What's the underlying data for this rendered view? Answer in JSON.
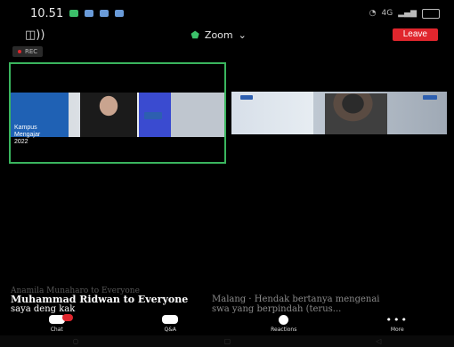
{
  "status": {
    "time": "10.51",
    "signal_text": "4G"
  },
  "header": {
    "meeting_title": "Zoom",
    "leave_label": "Leave"
  },
  "recording": {
    "label": "REC"
  },
  "video_left": {
    "brand_line1": "Kampus",
    "brand_line2": "Mengajar",
    "brand_line3": "2022"
  },
  "chat": {
    "previous_sender": "Anamila Munaharo to Everyone",
    "sender": "Muhammad Ridwan to Everyone",
    "sender_faded": "Malang · Hendak bertanya mengenai",
    "message": "saya deng kak",
    "message_faded": "swa yang berpindah (terus..."
  },
  "toolbar": {
    "chat_label": "Chat",
    "qa_label": "Q&A",
    "reactions_label": "Reactions",
    "more_label": "More"
  },
  "colors": {
    "leave": "#e0262d",
    "active_speaker": "#3ab55e",
    "secure": "#3cc26a"
  }
}
